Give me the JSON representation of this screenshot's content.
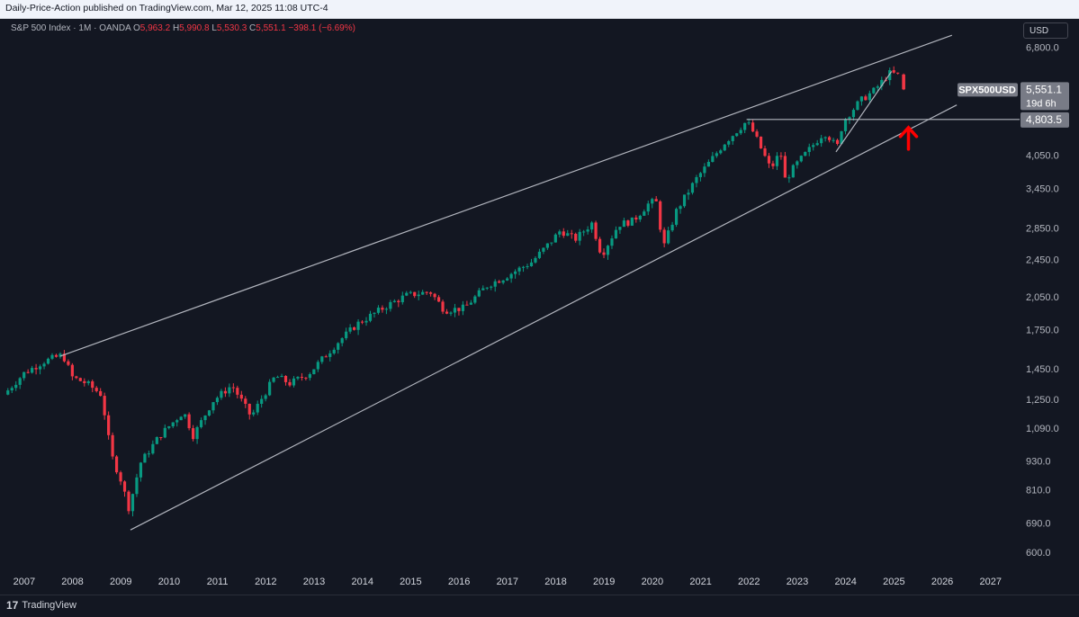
{
  "header": {
    "published": "Daily-Price-Action published on TradingView.com, Mar 12, 2025 11:08 UTC-4"
  },
  "legend": {
    "symbol": "S&P 500 Index · 1M · OANDA",
    "open_label": "O",
    "open": "5,963.2",
    "high_label": "H",
    "high": "5,990.8",
    "low_label": "L",
    "low": "5,530.3",
    "close_label": "C",
    "close": "5,551.1",
    "change": "−398.1 (−6.69%)"
  },
  "currency_button": "USD",
  "price_tags": {
    "symbol_label": "SPX500USD",
    "last_price": "5,551.1",
    "countdown": "19d 6h",
    "level_price": "4,803.5"
  },
  "footer": {
    "brand": "TradingView"
  },
  "colors": {
    "background": "#131722",
    "up_candle": "#089981",
    "down_candle": "#f23645",
    "trendline": "#b2b5be",
    "arrow": "#ff0000"
  },
  "chart_data": {
    "type": "candlestick",
    "symbol": "SPX500USD",
    "interval": "1M",
    "y_scale": "log",
    "ylim": [
      560,
      7300
    ],
    "y_ticks": [
      6800,
      4050,
      3450,
      2850,
      2450,
      2050,
      1750,
      1450,
      1250,
      1090,
      930,
      810,
      690,
      600
    ],
    "y_tick_labels": [
      "6,800.0",
      "4,050.0",
      "3,450.0",
      "2,850.0",
      "2,450.0",
      "2,050.0",
      "1,750.0",
      "1,450.0",
      "1,250.0",
      "1,090.0",
      "930.0",
      "810.0",
      "690.0",
      "600.0"
    ],
    "xlim": [
      2006.5,
      2027.6
    ],
    "x_ticks": [
      2007,
      2008,
      2009,
      2010,
      2011,
      2012,
      2013,
      2014,
      2015,
      2016,
      2017,
      2018,
      2019,
      2020,
      2021,
      2022,
      2023,
      2024,
      2025,
      2026,
      2027
    ],
    "x_tick_labels": [
      "2007",
      "2008",
      "2009",
      "2010",
      "2011",
      "2012",
      "2013",
      "2014",
      "2015",
      "2016",
      "2017",
      "2018",
      "2019",
      "2020",
      "2021",
      "2022",
      "2023",
      "2024",
      "2025",
      "2026",
      "2027"
    ],
    "close_anchors": [
      [
        2006.58,
        1280
      ],
      [
        2007.0,
        1420
      ],
      [
        2007.4,
        1500
      ],
      [
        2007.8,
        1550
      ],
      [
        2008.0,
        1390
      ],
      [
        2008.3,
        1350
      ],
      [
        2008.6,
        1280
      ],
      [
        2008.8,
        960
      ],
      [
        2009.0,
        850
      ],
      [
        2009.17,
        740
      ],
      [
        2009.4,
        920
      ],
      [
        2009.8,
        1050
      ],
      [
        2010.3,
        1180
      ],
      [
        2010.5,
        1050
      ],
      [
        2010.9,
        1240
      ],
      [
        2011.3,
        1340
      ],
      [
        2011.7,
        1150
      ],
      [
        2011.9,
        1250
      ],
      [
        2012.2,
        1400
      ],
      [
        2012.5,
        1350
      ],
      [
        2012.9,
        1420
      ],
      [
        2013.5,
        1650
      ],
      [
        2013.9,
        1800
      ],
      [
        2014.5,
        1960
      ],
      [
        2014.9,
        2060
      ],
      [
        2015.4,
        2100
      ],
      [
        2015.7,
        1920
      ],
      [
        2016.1,
        1940
      ],
      [
        2016.6,
        2170
      ],
      [
        2016.9,
        2240
      ],
      [
        2017.5,
        2420
      ],
      [
        2017.9,
        2670
      ],
      [
        2018.1,
        2820
      ],
      [
        2018.4,
        2700
      ],
      [
        2018.75,
        2920
      ],
      [
        2018.95,
        2500
      ],
      [
        2019.3,
        2900
      ],
      [
        2019.6,
        2950
      ],
      [
        2019.95,
        3230
      ],
      [
        2020.1,
        3220
      ],
      [
        2020.22,
        2580
      ],
      [
        2020.5,
        3100
      ],
      [
        2020.9,
        3600
      ],
      [
        2021.5,
        4300
      ],
      [
        2021.95,
        4760
      ],
      [
        2022.1,
        4500
      ],
      [
        2022.45,
        3780
      ],
      [
        2022.65,
        4120
      ],
      [
        2022.75,
        3590
      ],
      [
        2022.95,
        3840
      ],
      [
        2023.5,
        4450
      ],
      [
        2023.6,
        4500
      ],
      [
        2023.82,
        4190
      ],
      [
        2023.95,
        4770
      ],
      [
        2024.3,
        5250
      ],
      [
        2024.6,
        5530
      ],
      [
        2024.9,
        6000
      ],
      [
        2025.08,
        5960
      ],
      [
        2025.2,
        5551.1
      ]
    ],
    "last_candle": {
      "open": 5963.2,
      "high": 5990.8,
      "low": 5530.3,
      "close": 5551.1
    },
    "horizontal_line": {
      "price": 4803.5
    },
    "trendlines": [
      {
        "from": [
          2007.75,
          1540
        ],
        "to": [
          2026.2,
          7200
        ]
      },
      {
        "from": [
          2009.2,
          668
        ],
        "to": [
          2026.3,
          5150
        ]
      },
      {
        "from": [
          2023.8,
          4110
        ],
        "to": [
          2024.95,
          6050
        ]
      }
    ],
    "arrow": {
      "x": 2025.3,
      "price": 4620,
      "direction": "up"
    }
  }
}
